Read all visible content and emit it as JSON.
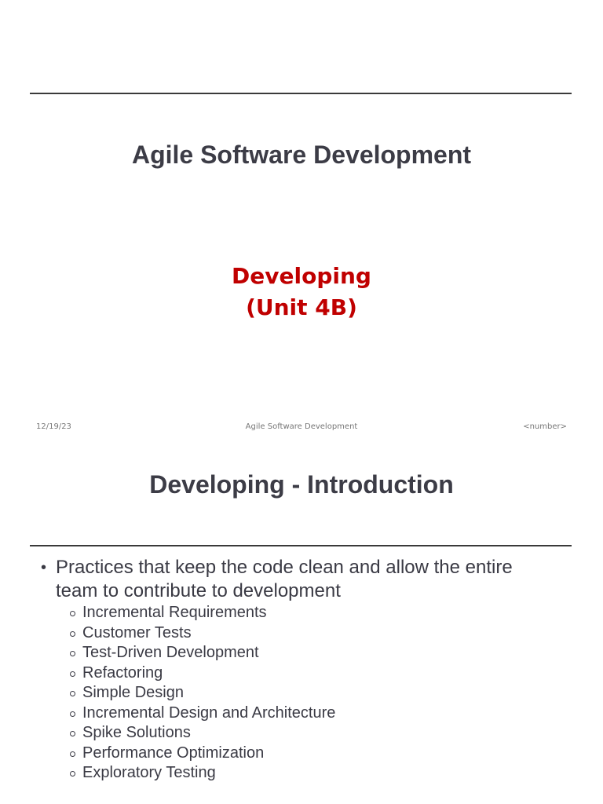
{
  "slide1": {
    "title": "Agile Software Development",
    "subtitle_line1": "Developing",
    "subtitle_line2": "(Unit 4B)",
    "footer": {
      "date": "12/19/23",
      "center": "Agile Software Development",
      "number": "<number>"
    },
    "colors": {
      "subtitle": "#c00000",
      "title": "#3c3c46"
    }
  },
  "slide2": {
    "title": "Developing - Introduction",
    "main_bullet": "Practices that keep the code clean and allow the entire team to contribute to development",
    "sub_bullets": [
      "Incremental Requirements",
      "Customer Tests",
      "Test-Driven Development",
      "Refactoring",
      "Simple Design",
      "Incremental Design and Architecture",
      "Spike Solutions",
      "Performance Optimization",
      "Exploratory Testing"
    ]
  }
}
